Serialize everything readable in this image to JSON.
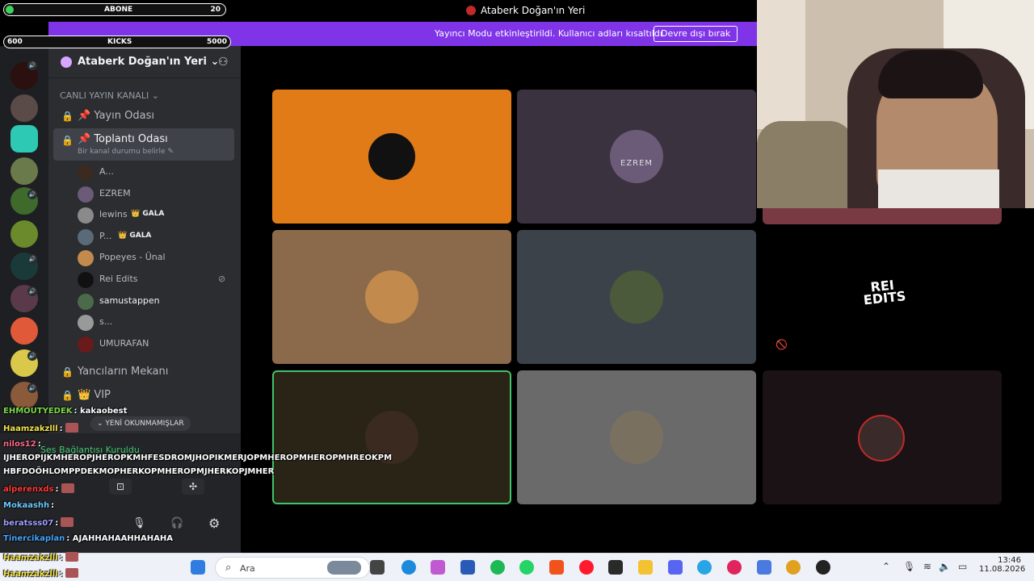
{
  "bars": {
    "subs": {
      "label": "ABONE",
      "value": "20",
      "progress": 0.04
    },
    "kicks": {
      "label": "KICKS",
      "start": "600",
      "goal": "5000",
      "progress": 0.0
    }
  },
  "window": {
    "title": "Ataberk Doğan'ın Yeri"
  },
  "notice": {
    "message": "Yayıncı Modu etkinleştirildi. Kullanıcı adları kısaltıldı.",
    "button": "Devre dışı bırak"
  },
  "guild": {
    "name": "Ataberk Doğan'ın Yeri ⌄"
  },
  "category": {
    "label": "CANLI YAYIN KANALI ⌄"
  },
  "channels": [
    {
      "name": "📌 Yayın Odası"
    },
    {
      "name": "📌 Toplantı Odası",
      "sub": "Bir kanal durumu belirle ✎"
    },
    {
      "name": "Yancıların Mekanı"
    },
    {
      "name": "👑 VIP"
    }
  ],
  "voice_users": [
    {
      "name": "A...",
      "color": "#3a2a20"
    },
    {
      "name": "EZREM",
      "color": "#6b5a78"
    },
    {
      "name": "lewins",
      "badge": "👑 GALA",
      "color": "#8a8a8a"
    },
    {
      "name": "P...",
      "badge": "👑 GALA",
      "color": "#5a6a78"
    },
    {
      "name": "Popeyes - Ünal",
      "color": "#c28a4c"
    },
    {
      "name": "Rei Edits",
      "color": "#111"
    },
    {
      "name": "samustappen",
      "color": "#4a6a4a"
    },
    {
      "name": "s...",
      "color": "#999"
    },
    {
      "name": "UMURAFAN",
      "color": "#6a1a1a"
    }
  ],
  "voice_panel": {
    "unread": "⌄ YENİ OKUNMAMIŞLAR",
    "status": "Ses Bağlantısı Kuruldu"
  },
  "chat": [
    {
      "nick": "EHMOUTYEDEK",
      "text": ": kakaobest",
      "color": "#7cd94a"
    },
    {
      "nick": "Haamzakzlll",
      "text": ":",
      "color": "#f2e34b",
      "emote": true
    },
    {
      "nick": "nilos12",
      "text": ":",
      "color": "#ff6a8a"
    },
    {
      "nick": "",
      "text": "IJHEROPIJKMHEROPJHEROPKMHFESDROMJHOPIKMERJOPMHEROPMHEROPMHREOKPM",
      "color": "#fff"
    },
    {
      "nick": "",
      "text": "HBFDOÖHLOMPPDEKMOPHERKOPMHEROPMJHERKOPJMHER",
      "color": "#fff"
    },
    {
      "nick": "alperenxds",
      "text": ":",
      "color": "#ff3a3a",
      "emote": true
    },
    {
      "nick": "Mokaashh",
      "text": ":",
      "color": "#6ec8ff"
    },
    {
      "nick": "beratsss07",
      "text": ":",
      "color": "#a0a0ff",
      "emote": true
    },
    {
      "nick": "Tinercikaplan",
      "text": ": AJAHHAHAAHHAHAHA",
      "color": "#46a7ff"
    },
    {
      "nick": "Haamzakzlll",
      "text": ":",
      "color": "#f2e34b",
      "emote": true
    },
    {
      "nick": "Haamzakzlll",
      "text": ":",
      "color": "#f2e34b",
      "emote": true
    }
  ],
  "tiles": [
    {
      "label": "",
      "bg": "#e07b18"
    },
    {
      "label": "EZREM",
      "bg": "#3a323e"
    },
    {
      "label": "",
      "bg": "#8a6a4a"
    },
    {
      "label": "",
      "bg": "#3c424a"
    },
    {
      "label": "REI EDITS",
      "bg": "#000"
    },
    {
      "label": "",
      "bg": "#2a2416"
    },
    {
      "label": "",
      "bg": "#6a6a6a"
    },
    {
      "label": "",
      "bg": "#1a1214"
    }
  ],
  "taskbar": {
    "search_placeholder": "Ara",
    "time": "13:46",
    "date": "11.08.2026"
  }
}
